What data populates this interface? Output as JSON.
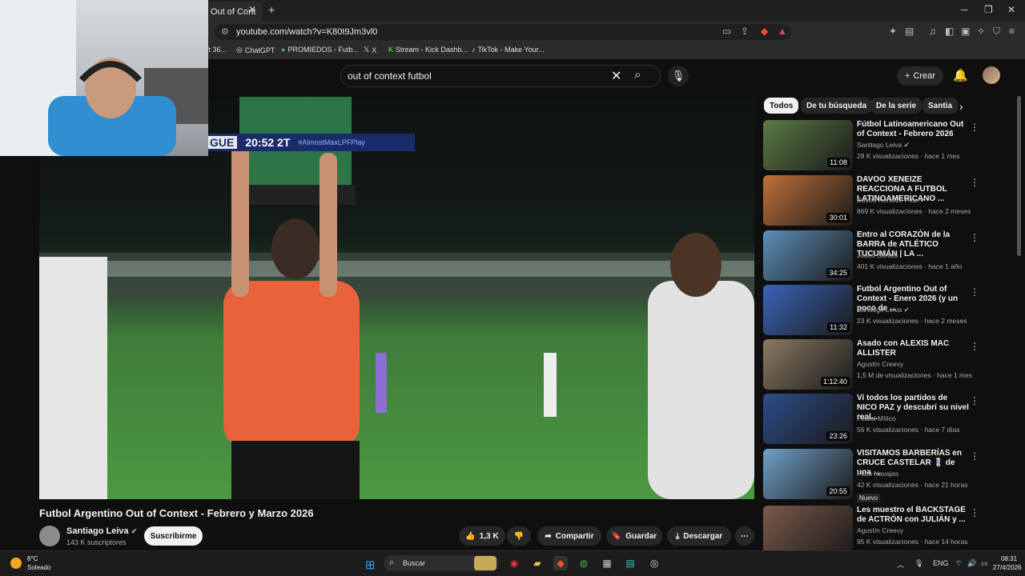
{
  "browser": {
    "tab_title": "Out of Cont",
    "url": "youtube.com/watch?v=K80t9Jm3vl0",
    "bookmarks": [
      {
        "label": "ft 36...",
        "icon": "bookmark-icon"
      },
      {
        "label": "ChatGPT",
        "icon": "chatgpt-icon"
      },
      {
        "label": "PROMIEDOS - Futb...",
        "icon": "promiedos-icon"
      },
      {
        "label": "X",
        "icon": "x-icon"
      },
      {
        "label": "Stream - Kick Dashb...",
        "icon": "kick-icon"
      },
      {
        "label": "TikTok - Make Your...",
        "icon": "tiktok-icon"
      }
    ]
  },
  "youtube": {
    "search_query": "out of context futbol",
    "create_label": "Crear",
    "chips": [
      "Todos",
      "De tu búsqueda",
      "De la serie",
      "Santia"
    ]
  },
  "video": {
    "scorebug_team": "GUE",
    "scorebug_time": "20:52 2T",
    "scorebug_tag": "#AlmostMaxLPFPlay",
    "title": "Futbol Argentino Out of Context - Febrero y Marzo 2026",
    "channel": "Santiago Leiva",
    "subscribers": "143 K suscriptores",
    "subscribe_label": "Suscribirme",
    "likes": "1,3 K",
    "share_label": "Compartir",
    "save_label": "Guardar",
    "download_label": "Descargar"
  },
  "recommendations": [
    {
      "title": "Fútbol Latinoamericano Out of Context - Febrero 2026",
      "channel": "Santiago Leiva",
      "verified": true,
      "meta": "28 K visualizaciones · hace 1 mes",
      "duration": "11:08",
      "badge": "",
      "thumb_color": "#5b7a45"
    },
    {
      "title": "DAVOO XENEIZE REACCIONA A FUTBOL LATINOAMERICANO ...",
      "channel": "Davoo Xeneize Plus",
      "verified": true,
      "meta": "869 K visualizaciones · hace 2 meses",
      "duration": "30:01",
      "badge": "",
      "thumb_color": "#c0713a"
    },
    {
      "title": "Entro al CORAZÓN de la BARRA de ATLÉTICO TUCUMÁN | LA ...",
      "channel": "Joaco Santos",
      "verified": false,
      "meta": "401 K visualizaciones · hace 1 año",
      "duration": "34:25",
      "badge": "",
      "thumb_color": "#5d8fb8"
    },
    {
      "title": "Futbol Argentino Out of Context - Enero 2026 (y un poco de ...",
      "channel": "Santiago Leiva",
      "verified": true,
      "meta": "23 K visualizaciones · hace 2 meses",
      "duration": "11:32",
      "badge": "",
      "thumb_color": "#3a64b8"
    },
    {
      "title": "Asado con ALEXIS MAC ALLISTER",
      "channel": "Agustín Creevy",
      "verified": false,
      "meta": "1,5 M de visualizaciones · hace 1 mes",
      "duration": "1:12:40",
      "badge": "",
      "thumb_color": "#8a7a62"
    },
    {
      "title": "Vi todos los partidos de NICO PAZ y descubrí su nivel real...",
      "channel": "Futbol Mítico",
      "verified": false,
      "meta": "56 K visualizaciones · hace 7 días",
      "duration": "23:26",
      "badge": "",
      "thumb_color": "#2c4c8a"
    },
    {
      "title": "VISITAMOS BARBERÍAS en CRUCE CASTELAR 💈 de una ...",
      "channel": "Facu Navajas",
      "verified": false,
      "meta": "42 K visualizaciones · hace 21 horas",
      "duration": "20:55",
      "badge": "Nuevo",
      "thumb_color": "#6fa0c8"
    },
    {
      "title": "Les muestro el BACKSTAGE de ACTRÓN con JULIÁN y ...",
      "channel": "Agustín Creevy",
      "verified": false,
      "meta": "95 K visualizaciones · hace 14 horas",
      "duration": "",
      "badge": "",
      "thumb_color": "#7a5a4a"
    }
  ],
  "taskbar": {
    "temperature": "8°C",
    "condition": "Soleado",
    "search_label": "Buscar",
    "language": "ENG",
    "time": "08:31",
    "date": "27/4/2026"
  }
}
